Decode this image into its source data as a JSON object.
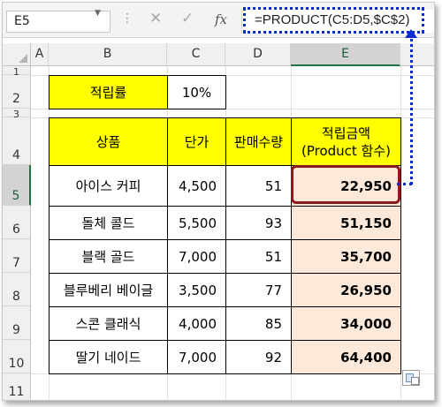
{
  "formula_bar": {
    "name_box": "E5",
    "formula": "=PRODUCT(C5:D5,$C$2)",
    "dots": "⋮",
    "cancel_glyph": "✕",
    "enter_glyph": "✓",
    "fx_label": "fx"
  },
  "columns": [
    "A",
    "B",
    "C",
    "D",
    "E"
  ],
  "rows": [
    "1",
    "2",
    "3",
    "4",
    "5",
    "6",
    "7",
    "8",
    "9",
    "10",
    "11"
  ],
  "rate": {
    "label": "적립률",
    "value": "10%"
  },
  "table": {
    "headers": {
      "product": "상품",
      "price": "단가",
      "qty": "판매수량",
      "amount_line1": "적립금액",
      "amount_line2": "(Product 함수)"
    },
    "rows": [
      {
        "product": "아이스 커피",
        "price": "4,500",
        "qty": "51",
        "amount": "22,950"
      },
      {
        "product": "돌체 콜드",
        "price": "5,500",
        "qty": "93",
        "amount": "51,150"
      },
      {
        "product": "블랙 골드",
        "price": "7,000",
        "qty": "51",
        "amount": "35,700"
      },
      {
        "product": "블루베리 베이글",
        "price": "3,500",
        "qty": "77",
        "amount": "26,950"
      },
      {
        "product": "스콘 클래식",
        "price": "4,000",
        "qty": "85",
        "amount": "34,000"
      },
      {
        "product": "딸기 네이드",
        "price": "7,000",
        "qty": "92",
        "amount": "64,400"
      }
    ]
  },
  "icons": {
    "name_box_dropdown": "chevron-down-icon",
    "cancel": "close-icon",
    "enter": "check-icon",
    "insert_function": "fx-icon",
    "paste_options": "paste-options-icon"
  },
  "colors": {
    "header_fill": "#ffff00",
    "amount_fill": "#fde9d9",
    "highlight_border": "#8b1a1a",
    "annotation_blue": "#0b2ccc",
    "selection_green": "#217346"
  }
}
